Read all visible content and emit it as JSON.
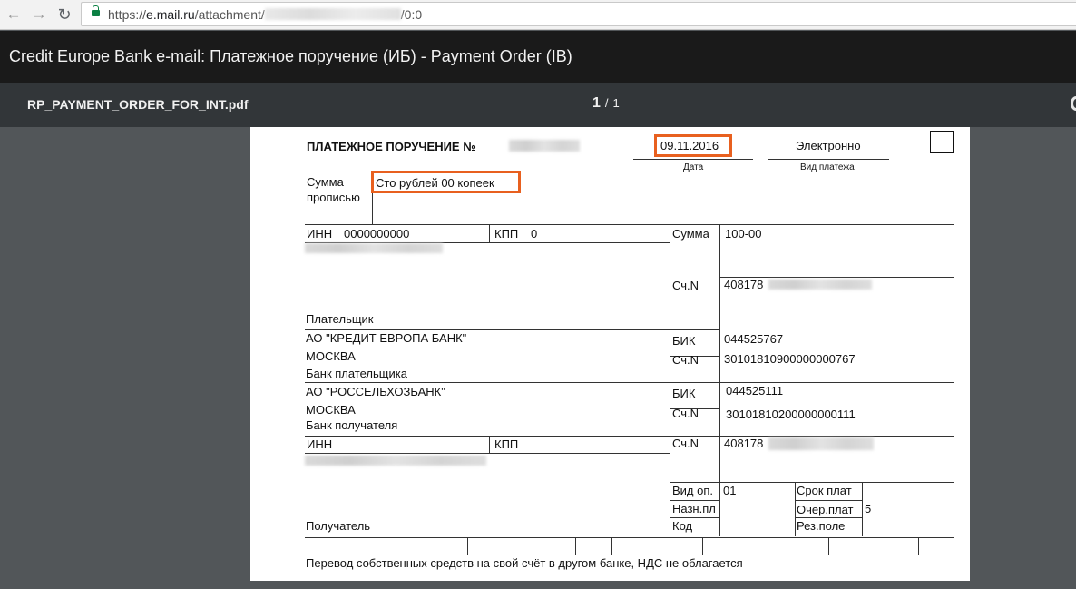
{
  "browser": {
    "url_prefix": "https://",
    "url_host": "e.mail.ru",
    "url_path": "/attachment/",
    "url_suffix": "/0:0"
  },
  "mail": {
    "title": "Credit Europe Bank e-mail: Платежное поручение (ИБ) - Payment Order (IB)"
  },
  "pdf": {
    "filename": "RP_PAYMENT_ORDER_FOR_INT.pdf",
    "current_page": "1",
    "page_sep": "/",
    "total_pages": "1"
  },
  "order": {
    "heading": "ПЛАТЕЖНОЕ ПОРУЧЕНИЕ №",
    "date": "09.11.2016",
    "date_label": "Дата",
    "payment_type": "Электронно",
    "payment_type_label": "Вид  платежа",
    "amount_words_label_1": "Сумма",
    "amount_words_label_2": "прописью",
    "amount_words": "Сто  рублей 00 копеек",
    "payer": {
      "inn_label": "ИНН",
      "inn": "0000000000",
      "kpp_label": "КПП",
      "kpp": "0",
      "label": "Плательщик"
    },
    "sum_label": "Сумма",
    "sum": "100-00",
    "acc_label": "Сч.N",
    "payer_account": "408178",
    "payer_bank": {
      "name": "АО \"КРЕДИТ ЕВРОПА БАНК\"",
      "city": "МОСКВА",
      "label": "Банк  плательщика",
      "bik_label": "БИК",
      "bik": "044525767",
      "corr_label": "Сч.N",
      "corr": "30101810900000000767"
    },
    "payee_bank": {
      "name": "АО \"РОССЕЛЬХОЗБАНК\"",
      "city": "МОСКВА",
      "label": "Банк получателя",
      "bik_label": "БИК",
      "bik": "044525111",
      "corr_label": "Сч.N",
      "corr": "30101810200000000111"
    },
    "payee": {
      "inn_label": "ИНН",
      "kpp_label": "КПП",
      "label": "Получатель",
      "acc_label": "Сч.N",
      "account": "408178"
    },
    "op_type_label": "Вид оп.",
    "op_type": "01",
    "purpose_code_label": "Назн.пл",
    "code_label": "Код",
    "term_label": "Срок плат",
    "priority_label": "Очер.плат",
    "priority": "5",
    "reserve_label": "Рез.поле",
    "purpose": "Перевод собственных средств на свой счёт в другом банке, НДС не облагается"
  }
}
